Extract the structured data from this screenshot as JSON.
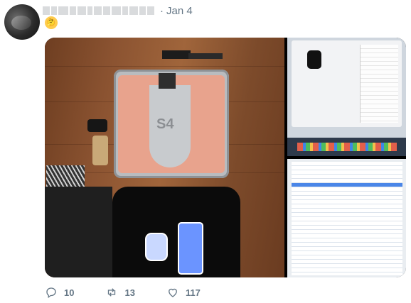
{
  "tweet": {
    "date": "Jan 4",
    "date_separator": "·",
    "emoji": "🤔",
    "icons": {
      "avatar": "avatar-photo",
      "reply": "reply-icon",
      "retweet": "retweet-icon",
      "like": "heart-icon"
    },
    "counts": {
      "replies": "10",
      "retweets": "13",
      "likes": "117"
    },
    "media": {
      "main_photo_label": "S4"
    }
  },
  "colors": {
    "text_secondary": "#657786",
    "emoji_face": "#ffcc4d"
  }
}
